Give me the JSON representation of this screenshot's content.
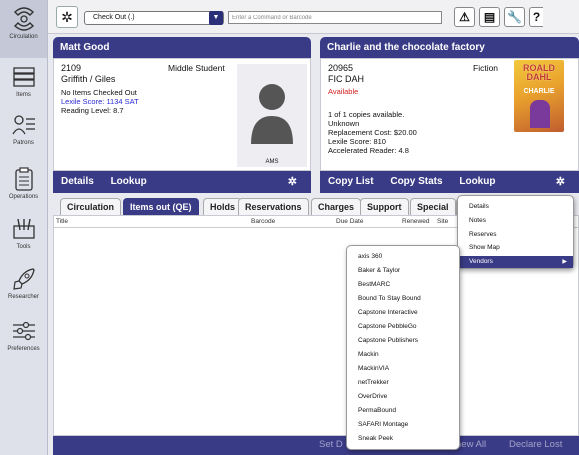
{
  "sidebar": {
    "items": [
      {
        "label": "Circulation"
      },
      {
        "label": "Items"
      },
      {
        "label": "Patrons"
      },
      {
        "label": "Operations"
      },
      {
        "label": "Tools"
      },
      {
        "label": "Researcher"
      },
      {
        "label": "Preferences"
      }
    ]
  },
  "toolbar": {
    "mode_value": "Check Out (.)",
    "command_placeholder": "Enter a Command or Barcode"
  },
  "patron": {
    "name": "Matt Good",
    "barcode": "2109",
    "grade": "Middle Student",
    "homeroom": "Griffith / Giles",
    "checked_out": "No Items Checked Out",
    "lexile": "Lexile Score: 1134 SAT",
    "reading_level": "Reading Level: 8.7",
    "photo_caption": "AMS",
    "footer_details": "Details",
    "footer_lookup": "Lookup"
  },
  "book": {
    "title": "Charlie and the chocolate factory",
    "barcode": "20965",
    "call_number": "FIC DAH",
    "status": "Available",
    "genre": "Fiction",
    "copies": "1 of 1 copies available.",
    "condition": "Unknown",
    "replacement_cost": "Replacement Cost: $20.00",
    "lexile": "Lexile Score: 810",
    "ar": "Accelerated Reader: 4.8",
    "cover_author": "ROALD DAHL",
    "cover_title": "CHARLIE",
    "footer_copy_list": "Copy List",
    "footer_copy_stats": "Copy Stats",
    "footer_lookup": "Lookup"
  },
  "tabs": [
    {
      "label": "Circulation"
    },
    {
      "label": "Items out (QE)"
    },
    {
      "label": "Holds"
    },
    {
      "label": "Reservations"
    },
    {
      "label": "Charges"
    },
    {
      "label": "Support"
    },
    {
      "label": "Special"
    },
    {
      "label": "C"
    }
  ],
  "table": {
    "headers": [
      "Title",
      "Barcode",
      "Due Date",
      "Renewed",
      "Site"
    ]
  },
  "bottom_actions": {
    "set_due": "Set D",
    "renew_all": "new All",
    "declare_lost": "Declare Lost"
  },
  "context_menu": {
    "items": [
      "Details",
      "Notes",
      "Reserves",
      "Show Map",
      "Vendors"
    ],
    "submenu_arrow": "▶"
  },
  "vendors_menu": {
    "items": [
      "axis 360",
      "Baker & Taylor",
      "BestMARC",
      "Bound To Stay Bound",
      "Capstone Interactive",
      "Capstone PebbleGo",
      "Capstone Publishers",
      "Mackin",
      "MackinVIA",
      "netTrekker",
      "OverDrive",
      "PermaBound",
      "SAFARI Montage",
      "Sneak Peek"
    ]
  },
  "colors": {
    "accent": "#3a3b86",
    "link_blue": "#2b2bd0",
    "status_red": "#d21f1f"
  }
}
